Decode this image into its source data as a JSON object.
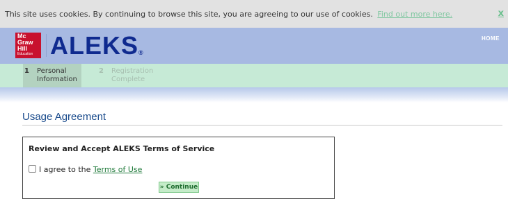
{
  "cookie_banner": {
    "message": "This site uses cookies. By continuing to browse this site, you are agreeing to our use of cookies.",
    "link_text": "Find out more here.",
    "close_label": "x"
  },
  "header": {
    "publisher_logo": {
      "line1": "Mc",
      "line2": "Graw",
      "line3": "Hill",
      "line4": "Education"
    },
    "product_logo": "ALEKS",
    "product_logo_mark": "®",
    "home_label": "HOME"
  },
  "steps": [
    {
      "number": "1",
      "label_line1": "Personal",
      "label_line2": "Information",
      "state": "active"
    },
    {
      "number": "2",
      "label_line1": "Registration",
      "label_line2": "Complete",
      "state": "inactive"
    }
  ],
  "main": {
    "page_title": "Usage Agreement",
    "tos": {
      "heading": "Review and Accept ALEKS Terms of Service",
      "agree_prefix": "I agree to the",
      "terms_link": "Terms of Use",
      "checked": false,
      "continue_label": "» Continue"
    }
  },
  "colors": {
    "header_bg": "#a7b9e2",
    "steps_bg": "#c6ead6",
    "brand_blue": "#0f2a8f",
    "publisher_red": "#c8102e",
    "link_green": "#1f7a3a"
  }
}
